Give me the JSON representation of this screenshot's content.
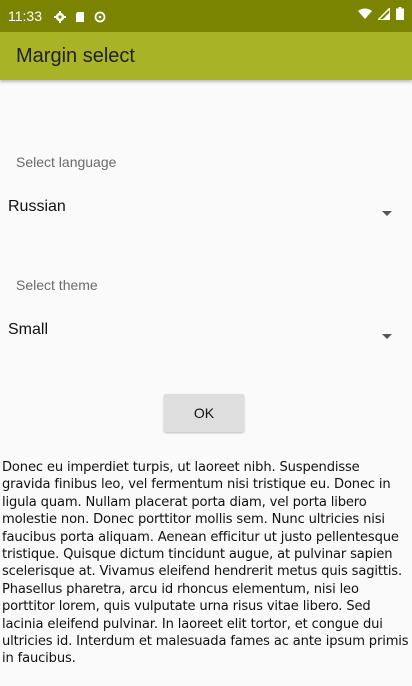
{
  "status_bar": {
    "time": "11:33",
    "left_icons": [
      "settings-icon",
      "sd-card-icon",
      "sync-icon"
    ],
    "right_icons": [
      "wifi-icon",
      "signal-icon",
      "battery-icon"
    ],
    "background": "#7a8400"
  },
  "app_bar": {
    "title": "Margin select",
    "background": "#a8b326"
  },
  "language": {
    "label": "Select language",
    "value": "Russian"
  },
  "theme": {
    "label": "Select theme",
    "value": "Small"
  },
  "ok_button": {
    "label": "OK"
  },
  "body_text": "Donec eu imperdiet turpis, ut laoreet nibh. Suspendisse gravida finibus leo, vel fermentum nisi tristique eu. Donec in ligula quam. Nullam placerat porta diam, vel porta libero molestie non. Donec porttitor mollis sem. Nunc ultricies nisi faucibus porta aliquam. Aenean efficitur ut justo pellentesque tristique. Quisque dictum tincidunt augue, at pulvinar sapien scelerisque at. Vivamus eleifend hendrerit metus quis sagittis. Phasellus pharetra, arcu id rhoncus elementum, nisi leo porttitor lorem, quis vulputate urna risus vitae libero. Sed lacinia eleifend pulvinar. In laoreet elit tortor, et congue dui ultricies id. Interdum et malesuada fames ac ante ipsum primis in faucibus."
}
